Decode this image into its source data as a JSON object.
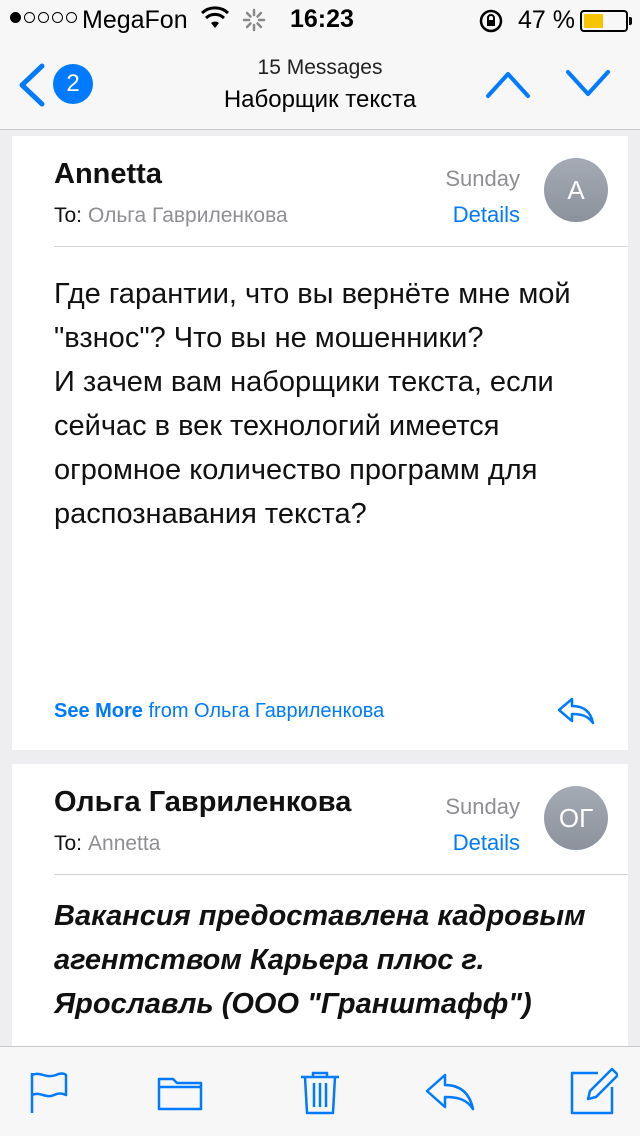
{
  "status_bar": {
    "carrier": "MegaFon",
    "time": "16:23",
    "battery_percent": "47 %",
    "battery_level": 0.47,
    "signal_bars": 1
  },
  "nav": {
    "unread_badge": "2",
    "message_count": "15 Messages",
    "title": "Наборщик текста"
  },
  "messages": [
    {
      "sender": "Annetta",
      "to_label": "To:",
      "to_name": "Ольга Гавриленкова",
      "date": "Sunday",
      "details": "Details",
      "avatar_initials": "A",
      "body_paragraphs": [
        "Где гарантии, что вы вернёте мне мой \"взнос\"? Что вы не мошенники?",
        "И зачем вам наборщики текста, если сейчас в век технологий имеется огромное количество программ для распознавания текста?"
      ],
      "see_more": "See More",
      "see_more_from": "from Ольга Гавриленкова"
    },
    {
      "sender": "Ольга Гавриленкова",
      "to_label": "To:",
      "to_name": "Annetta",
      "date": "Sunday",
      "details": "Details",
      "avatar_initials": "ОГ",
      "body_preview": "Вакансия предоставлена кадровым агентством Карьера плюс г. Ярославль (ООО \"Гранштафф\")"
    }
  ],
  "toolbar": {
    "icons": [
      "flag-icon",
      "folder-icon",
      "trash-icon",
      "reply-icon",
      "compose-icon"
    ]
  },
  "colors": {
    "accent": "#007aff",
    "secondary_text": "#8e8e93",
    "battery": "#f7c500"
  }
}
